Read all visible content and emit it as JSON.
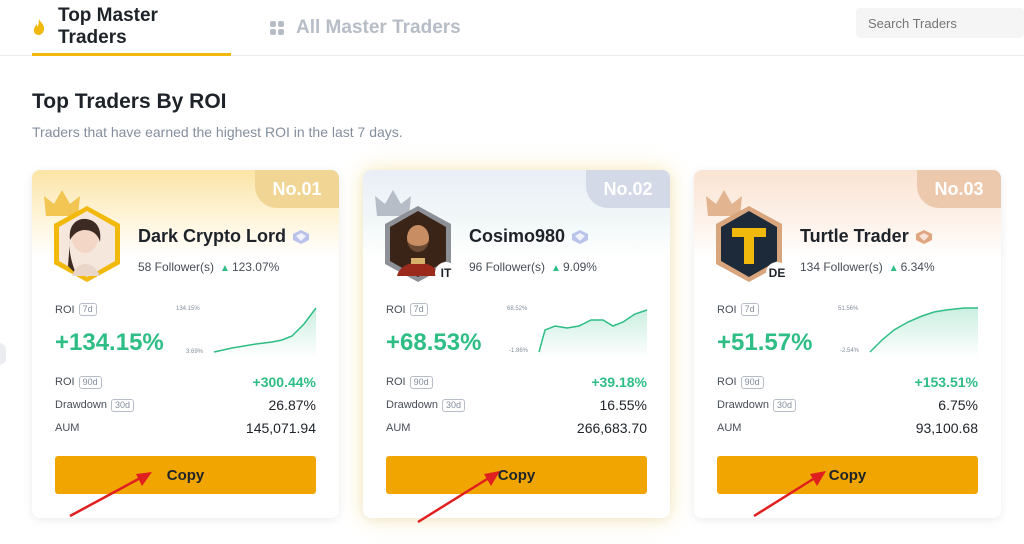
{
  "nav": {
    "tabs": [
      {
        "label": "Top Master Traders",
        "active": true,
        "icon": "flame-icon"
      },
      {
        "label": "All Master Traders",
        "active": false,
        "icon": "grid-icon"
      }
    ],
    "search_placeholder": "Search Traders"
  },
  "section": {
    "title": "Top Traders By ROI",
    "subtitle": "Traders that have earned the highest ROI in the last 7 days."
  },
  "labels": {
    "roi": "ROI",
    "period_7d": "7d",
    "period_90d": "90d",
    "period_30d": "30d",
    "drawdown": "Drawdown",
    "aum": "AUM",
    "copy": "Copy"
  },
  "colors": {
    "accent": "#f0a500",
    "positive": "#2ebd85",
    "tab_underline": "#f0b90b"
  },
  "traders": [
    {
      "rank": "No.01",
      "name": "Dark Crypto Lord",
      "country": "",
      "followers": "58 Follower(s)",
      "follower_change": "123.07%",
      "roi_7d": "+134.15%",
      "chart_max": "134.15%",
      "chart_min": "3.69%",
      "roi_90d": "+300.44%",
      "drawdown_30d": "26.87%",
      "aum": "145,071.94"
    },
    {
      "rank": "No.02",
      "name": "Cosimo980",
      "country": "IT",
      "followers": "96 Follower(s)",
      "follower_change": "9.09%",
      "roi_7d": "+68.53%",
      "chart_max": "68.52%",
      "chart_min": "-1.86%",
      "roi_90d": "+39.18%",
      "drawdown_30d": "16.55%",
      "aum": "266,683.70"
    },
    {
      "rank": "No.03",
      "name": "Turtle Trader",
      "country": "DE",
      "followers": "134 Follower(s)",
      "follower_change": "6.34%",
      "roi_7d": "+51.57%",
      "chart_max": "51.56%",
      "chart_min": "-2.54%",
      "roi_90d": "+153.51%",
      "drawdown_30d": "6.75%",
      "aum": "93,100.68"
    }
  ]
}
